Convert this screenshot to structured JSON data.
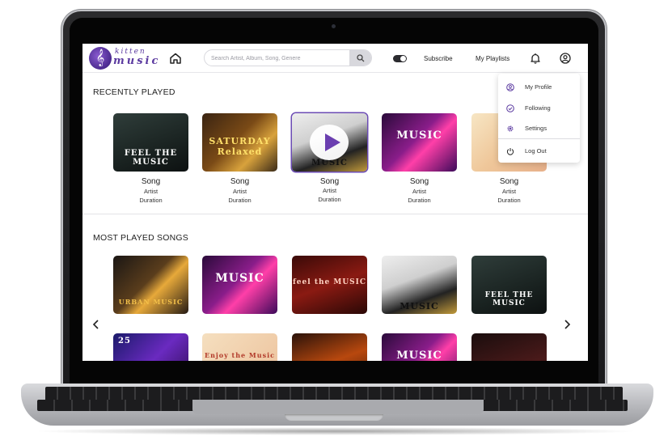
{
  "header": {
    "logo_line1": "kitten",
    "logo_line2": "music",
    "logo_glyph": "𝄞",
    "search_placeholder": "Search Artist, Album, Song, Genere",
    "subscribe": "Subscribe",
    "my_playlists": "My Playlists"
  },
  "icons": {
    "home": "home-icon",
    "search": "search-icon",
    "toggle": "dark-mode-toggle",
    "bell": "bell-icon",
    "user": "user-icon",
    "prev": "chevron-left-icon",
    "next": "chevron-right-icon",
    "play": "play-icon"
  },
  "dropdown": {
    "items": [
      {
        "label": "My Profile",
        "icon": "user-circle-icon"
      },
      {
        "label": "Following",
        "icon": "check-circle-icon"
      },
      {
        "label": "Settings",
        "icon": "gear-icon"
      },
      {
        "label": "Log Out",
        "icon": "power-icon"
      }
    ]
  },
  "recently_played": {
    "title": "RECENTLY PLAYED",
    "cards": [
      {
        "song": "Song",
        "artist": "Artist",
        "duration": "Duration",
        "art_text": "FEEL THE MUSIC"
      },
      {
        "song": "Song",
        "artist": "Artist",
        "duration": "Duration",
        "art_text": "SATURDAY Relaxed"
      },
      {
        "song": "Song",
        "artist": "Artist",
        "duration": "Duration",
        "art_text": "MUSIC"
      },
      {
        "song": "Song",
        "artist": "Artist",
        "duration": "Duration",
        "art_text": "MUSIC"
      },
      {
        "song": "Song",
        "artist": "Artist",
        "duration": "Duration",
        "art_text": ""
      }
    ]
  },
  "most_played": {
    "title": "MOST PLAYED SONGS",
    "row1_art": [
      "URBAN MUSIC",
      "MUSIC",
      "feel the MUSIC",
      "MUSIC",
      "FEEL THE MUSIC"
    ],
    "row2_art": [
      "25",
      "Enjoy the Music",
      "",
      "MUSIC",
      ""
    ]
  },
  "colors": {
    "accent": "#6b3fb0",
    "brand": "#5b3aa0"
  }
}
